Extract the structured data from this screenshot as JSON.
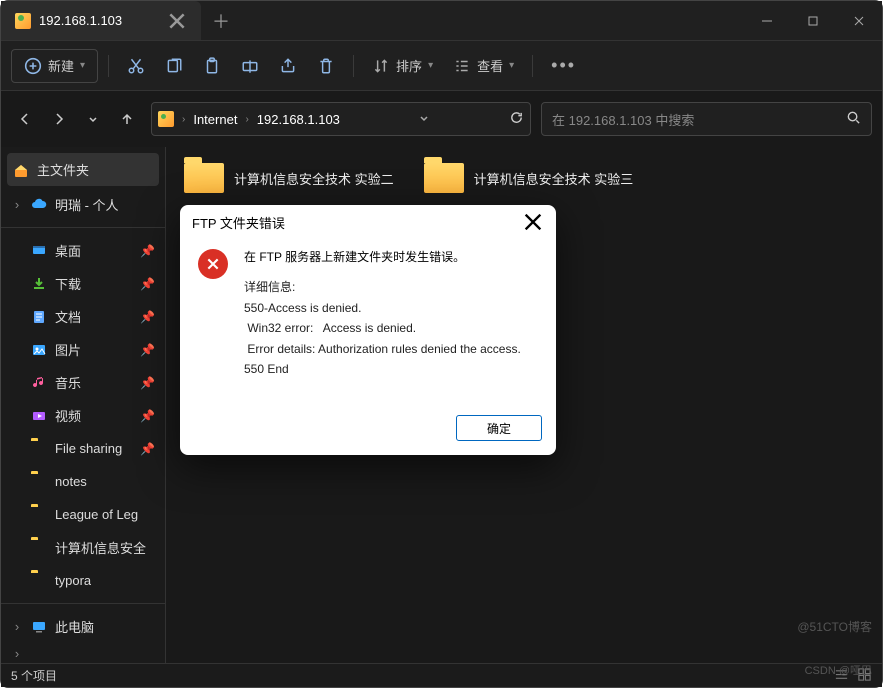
{
  "titlebar": {
    "tab_title": "192.168.1.103"
  },
  "toolbar": {
    "new_label": "新建",
    "sort_label": "排序",
    "view_label": "查看"
  },
  "nav": {
    "crumbs": [
      "Internet",
      "192.168.1.103"
    ],
    "search_placeholder": "在 192.168.1.103 中搜索"
  },
  "sidebar": {
    "home": "主文件夹",
    "user": "明瑞 - 个人",
    "quick": [
      {
        "icon": "desktop",
        "label": "桌面",
        "pin": true,
        "color": "#3aa7ff"
      },
      {
        "icon": "download",
        "label": "下载",
        "pin": true,
        "color": "#57c038"
      },
      {
        "icon": "doc",
        "label": "文档",
        "pin": true,
        "color": "#5fa8ff"
      },
      {
        "icon": "picture",
        "label": "图片",
        "pin": true,
        "color": "#3aa7ff"
      },
      {
        "icon": "music",
        "label": "音乐",
        "pin": true,
        "color": "#ff5f9e"
      },
      {
        "icon": "video",
        "label": "视频",
        "pin": true,
        "color": "#b35cff"
      }
    ],
    "folders": [
      "File sharing",
      "notes",
      "League of Leg",
      "计算机信息安全",
      "typora"
    ],
    "thispc": "此电脑"
  },
  "content": {
    "items": [
      "计算机信息安全技术 实验二",
      "计算机信息安全技术 实验三"
    ]
  },
  "dialog": {
    "title": "FTP 文件夹错误",
    "heading": "在 FTP 服务器上新建文件夹时发生错误。",
    "details_label": "详细信息:",
    "details_lines": [
      "550-Access is denied.",
      " Win32 error:   Access is denied.",
      " Error details: Authorization rules denied the access.",
      "550 End"
    ],
    "ok": "确定"
  },
  "status": {
    "text": "5 个项目"
  },
  "watermarks": {
    "top": "@51CTO博客",
    "bottom": "CSDN @哑巴"
  }
}
